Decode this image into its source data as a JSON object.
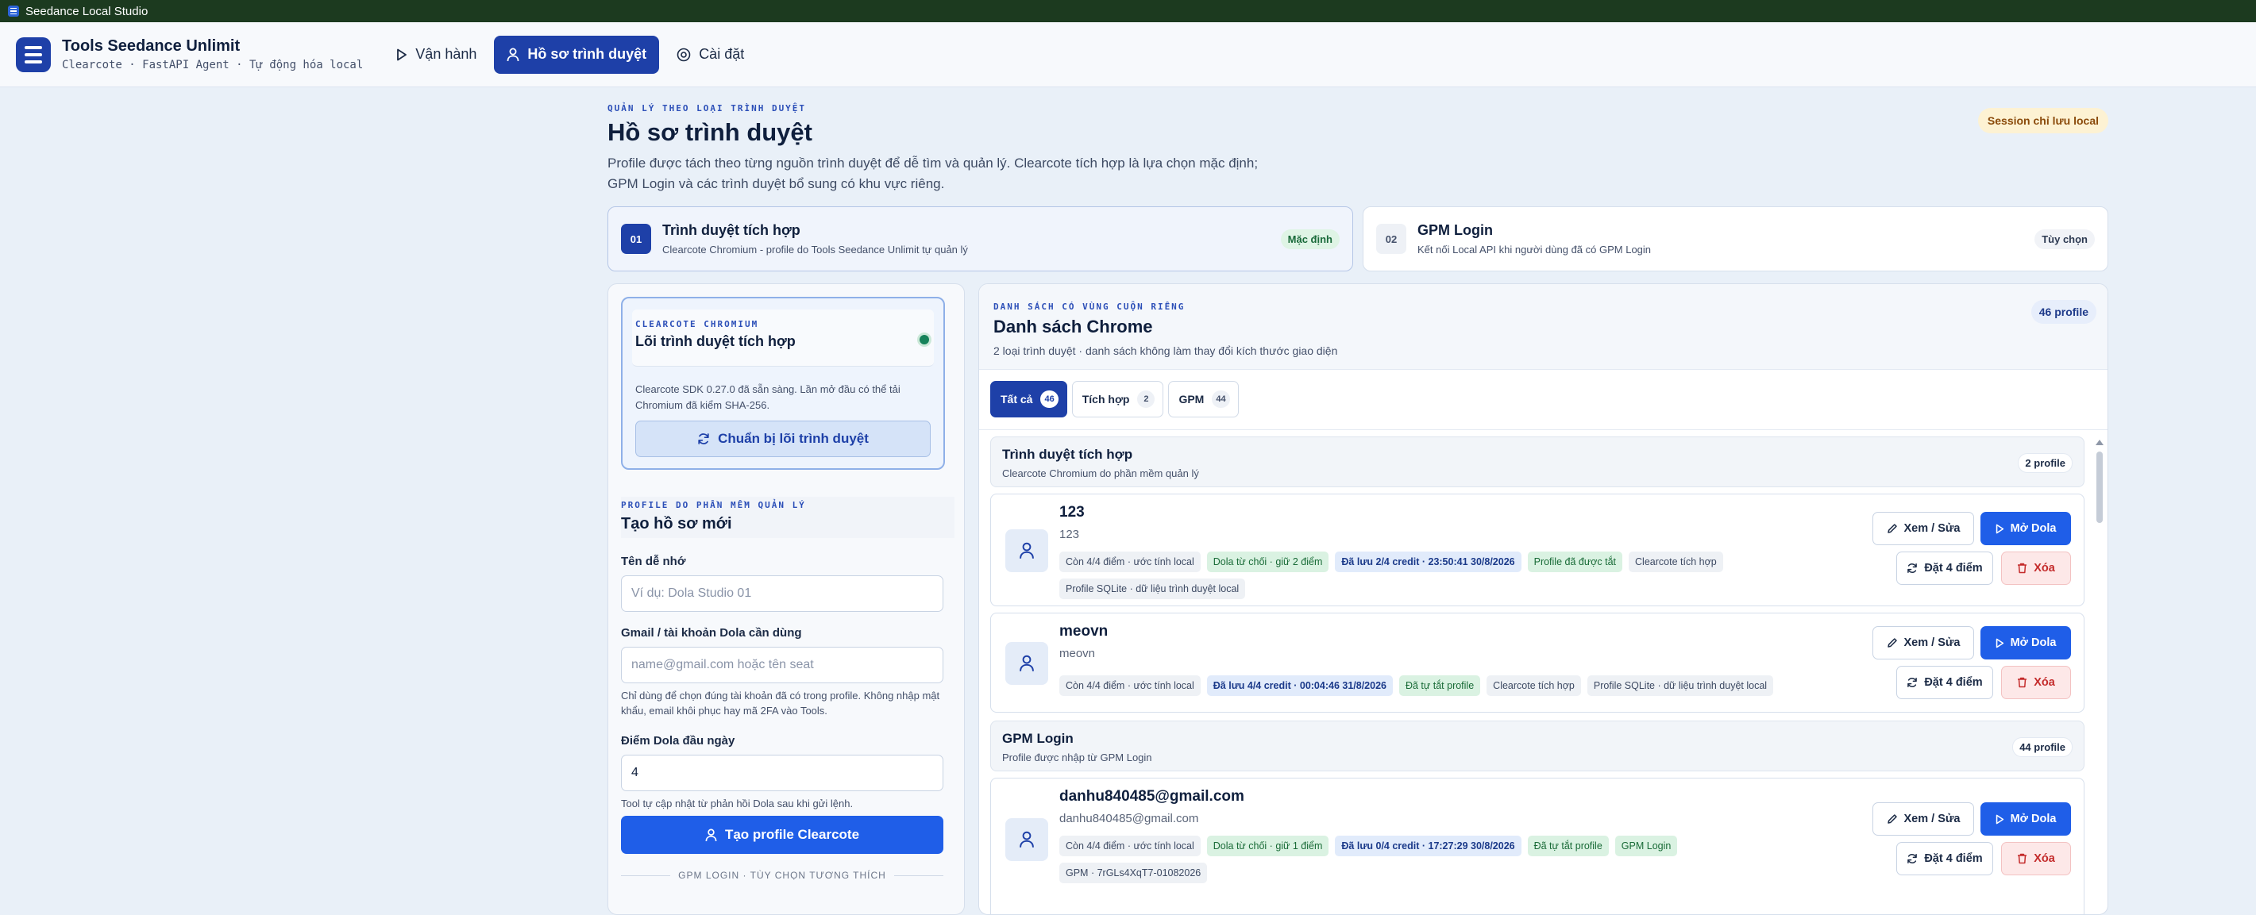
{
  "window": {
    "title": "Seedance Local Studio"
  },
  "app": {
    "name": "Tools Seedance Unlimit",
    "subtitle": "Clearcote · FastAPI Agent · Tự động hóa local"
  },
  "nav": {
    "items": [
      {
        "label": "Vận hành",
        "icon": "play-icon"
      },
      {
        "label": "Hồ sơ trình duyệt",
        "icon": "user-icon",
        "active": true
      },
      {
        "label": "Cài đặt",
        "icon": "gear-icon"
      }
    ]
  },
  "page": {
    "kicker": "QUẢN LÝ THEO LOẠI TRÌNH DUYỆT",
    "title": "Hồ sơ trình duyệt",
    "desc_line1": "Profile được tách theo từng nguồn trình duyệt để dễ tìm và quản lý. Clearcote tích hợp là lựa chọn mặc định;",
    "desc_line2": "GPM Login và các trình duyệt bổ sung có khu vực riêng.",
    "session_badge": "Session chỉ lưu local"
  },
  "browser_tabs": [
    {
      "num": "01",
      "title": "Trình duyệt tích hợp",
      "sub": "Clearcote Chromium - profile do Tools Seedance Unlimit tự quản lý",
      "tag": "Mặc định"
    },
    {
      "num": "02",
      "title": "GPM Login",
      "sub": "Kết nối Local API khi người dùng đã có GPM Login",
      "tag": "Tùy chọn"
    }
  ],
  "core": {
    "kicker": "CLEARCOTE CHROMIUM",
    "title": "Lõi trình duyệt tích hợp",
    "desc": "Clearcote SDK 0.27.0 đã sẵn sàng. Lần mở đầu có thể tải Chromium đã kiểm SHA-256.",
    "button": "Chuẩn bị lõi trình duyệt",
    "status_color": "#16825a"
  },
  "create": {
    "kicker": "PROFILE DO PHẦN MỀM QUẢN LÝ",
    "title": "Tạo hồ sơ mới",
    "name_label": "Tên dễ nhớ",
    "name_placeholder": "Ví dụ: Dola Studio 01",
    "gmail_label": "Gmail / tài khoản Dola cần dùng",
    "gmail_placeholder": "name@gmail.com hoặc tên seat",
    "gmail_help": "Chỉ dùng để chọn đúng tài khoản đã có trong profile. Không nhập mật khẩu, email khôi phục hay mã 2FA vào Tools.",
    "points_label": "Điểm Dola đầu ngày",
    "points_value": "4",
    "points_help": "Tool tự cập nhật từ phản hồi Dola sau khi gửi lệnh.",
    "button": "Tạo profile Clearcote",
    "divider": "GPM LOGIN · TÙY CHỌN TƯƠNG THÍCH"
  },
  "list": {
    "kicker": "DANH SÁCH CÓ VÙNG CUỘN RIÊNG",
    "title": "Danh sách Chrome",
    "sub": "2 loại trình duyệt · danh sách không làm thay đổi kích thước giao diện",
    "count": "46 profile",
    "filters": [
      {
        "label": "Tất cả",
        "count": "46"
      },
      {
        "label": "Tích hợp",
        "count": "2"
      },
      {
        "label": "GPM",
        "count": "44"
      }
    ]
  },
  "groups": [
    {
      "title": "Trình duyệt tích hợp",
      "sub": "Clearcote Chromium do phần mềm quản lý",
      "badge": "2 profile"
    },
    {
      "title": "GPM Login",
      "sub": "Profile được nhập từ GPM Login",
      "badge": "44 profile"
    }
  ],
  "actions": {
    "edit": "Xem / Sửa",
    "open": "Mở Dola",
    "set": "Đặt 4 điểm",
    "delete": "Xóa"
  },
  "profiles": [
    {
      "name": "123",
      "sub": "123",
      "chips": [
        {
          "text": "Còn 4/4 điểm · ước tính local",
          "kind": "gray"
        },
        {
          "text": "Dola từ chối · giữ 2 điểm",
          "kind": "green"
        },
        {
          "text": "Đã lưu 2/4 credit · 23:50:41 30/8/2026",
          "kind": "blue"
        },
        {
          "text": "Profile đã được tắt",
          "kind": "green"
        },
        {
          "text": "Clearcote tích hợp",
          "kind": "gray"
        },
        {
          "text": "Profile SQLite · dữ liệu trình duyệt local",
          "kind": "gray"
        }
      ]
    },
    {
      "name": "meovn",
      "sub": "meovn",
      "chips": [
        {
          "text": "Còn 4/4 điểm · ước tính local",
          "kind": "gray"
        },
        {
          "text": "Đã lưu 4/4 credit · 00:04:46 31/8/2026",
          "kind": "blue"
        },
        {
          "text": "Đã tự tắt profile",
          "kind": "green"
        },
        {
          "text": "Clearcote tích hợp",
          "kind": "gray"
        },
        {
          "text": "Profile SQLite · dữ liệu trình duyệt local",
          "kind": "gray"
        }
      ]
    },
    {
      "name": "danhu840485@gmail.com",
      "sub": "danhu840485@gmail.com",
      "chips": [
        {
          "text": "Còn 4/4 điểm · ước tính local",
          "kind": "gray"
        },
        {
          "text": "Dola từ chối · giữ 1 điểm",
          "kind": "green"
        },
        {
          "text": "Đã lưu 0/4 credit · 17:27:29 30/8/2026",
          "kind": "blue"
        },
        {
          "text": "Đã tự tắt profile",
          "kind": "green"
        },
        {
          "text": "GPM Login",
          "kind": "green"
        },
        {
          "text": "GPM · 7rGLs4XqT7-01082026",
          "kind": "gray"
        }
      ]
    }
  ]
}
